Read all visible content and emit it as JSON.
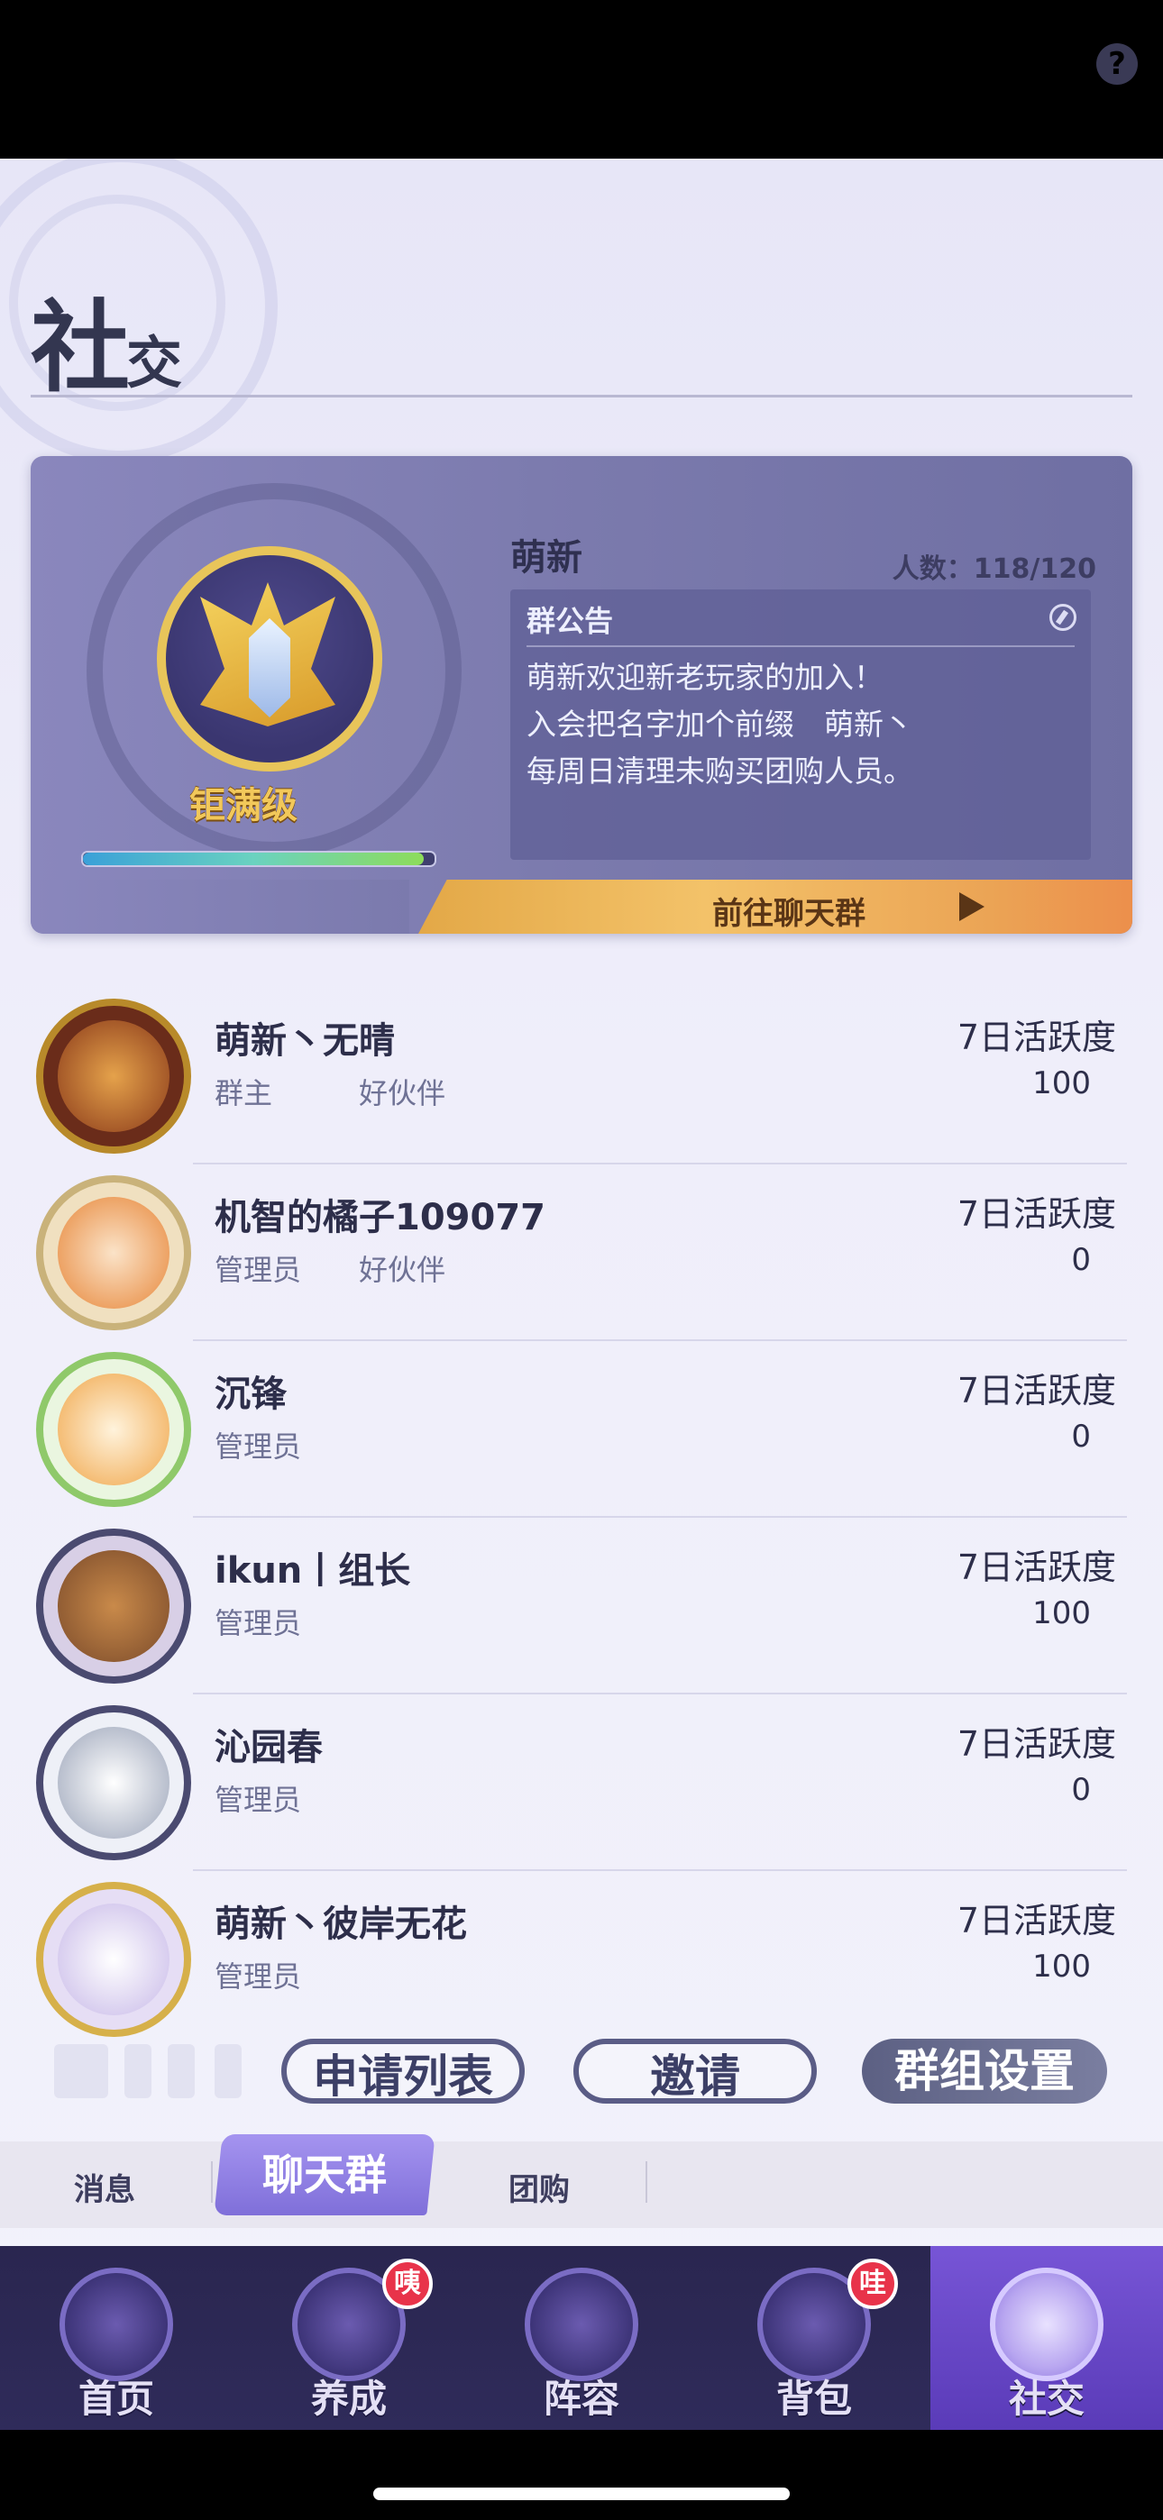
{
  "header": {
    "help_icon": "question-circle-icon"
  },
  "page": {
    "title_big": "社",
    "title_small": "交"
  },
  "group": {
    "name": "萌新",
    "member_count": "人数：118/120",
    "level_label": "钜满级",
    "exp_progress": 0.97,
    "notice_title": "群公告",
    "notice_lines": [
      "萌新欢迎新老玩家的加入！",
      "入会把名字加个前缀　萌新丶",
      "每周日清理未购买团购人员。"
    ],
    "goto_chat_label": "前往聊天群"
  },
  "members": [
    {
      "name": "萌新丶无晴",
      "role": "群主",
      "partner": "好伙伴",
      "activity_label": "7日活跃度",
      "activity": "100"
    },
    {
      "name": "机智的橘子109077",
      "role": "管理员",
      "partner": "好伙伴",
      "activity_label": "7日活跃度",
      "activity": "0"
    },
    {
      "name": "沉锋",
      "role": "管理员",
      "partner": "",
      "activity_label": "7日活跃度",
      "activity": "0"
    },
    {
      "name": "ikun丨组长",
      "role": "管理员",
      "partner": "",
      "activity_label": "7日活跃度",
      "activity": "100"
    },
    {
      "name": "沁园春",
      "role": "管理员",
      "partner": "",
      "activity_label": "7日活跃度",
      "activity": "0"
    },
    {
      "name": "萌新丶彼岸无花",
      "role": "管理员",
      "partner": "",
      "activity_label": "7日活跃度",
      "activity": "100"
    }
  ],
  "actions": {
    "apply_list": "申请列表",
    "invite": "邀请",
    "group_settings": "群组设置"
  },
  "subtabs": {
    "messages": "消息",
    "chat_group": "聊天群",
    "group_buy": "团购"
  },
  "nav": [
    {
      "label": "首页",
      "badge": "",
      "icon": "home-icon"
    },
    {
      "label": "养成",
      "badge": "咦",
      "icon": "train-icon"
    },
    {
      "label": "阵容",
      "badge": "",
      "icon": "lineup-icon"
    },
    {
      "label": "背包",
      "badge": "哇",
      "icon": "backpack-icon"
    },
    {
      "label": "社交",
      "badge": "",
      "icon": "social-icon"
    }
  ],
  "colors": {
    "accent": "#7f6fd9",
    "badge_red": "#e8334a",
    "goto_button": "#f3c269"
  }
}
